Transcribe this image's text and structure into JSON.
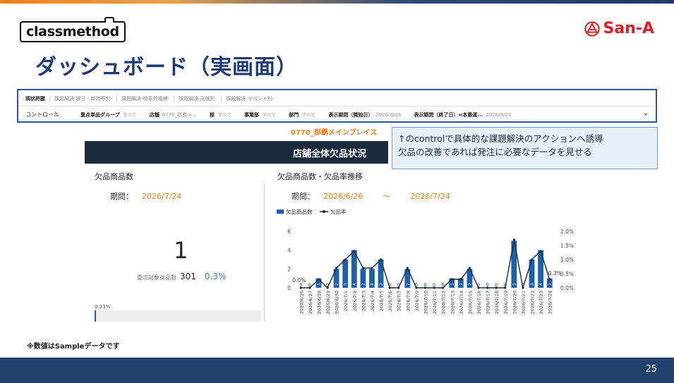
{
  "header": {
    "brand_left": "classmethod",
    "brand_right": "San-A",
    "title": "ダッシュボード（実画面）",
    "accent_color": "#1f3a70"
  },
  "filters": {
    "tabs": [
      "現状把握",
      "課題解決-曜日・時間帯別-",
      "課題解決-時系列推移-",
      "課題解決-天候別-",
      "課題解決-イベント別-"
    ],
    "active_tab": 0,
    "controls_label": "コントロール",
    "controls": [
      {
        "name": "重点単品グループ",
        "value": "すべて"
      },
      {
        "name": "店舗",
        "value": "0770_那覇メ..."
      },
      {
        "name": "部",
        "value": "すべて"
      },
      {
        "name": "事業部",
        "value": "すべて"
      },
      {
        "name": "部門",
        "value": "すべて"
      },
      {
        "name": "表示期間（開始日）",
        "value": "2026/6/26"
      },
      {
        "name": "表示期間（終了日）=本番運...",
        "value": "2026/7/24"
      }
    ]
  },
  "store_name": "0770_那覇メインプレイス",
  "banner_title": "店舗全体欠品状況",
  "callout": {
    "line1": "↑のcontrolで具体的な課題解決のアクションへ誘導",
    "line2": "欠品の改善であれば発注に必要なデータを見せる"
  },
  "left_panel": {
    "title": "欠品商品数",
    "period_label": "期間：",
    "period_date": "2026/7/24",
    "value": "1",
    "sub_label": "重点対象商品数",
    "sub_value": "301",
    "sub_rate": "0.3%",
    "gauge_label": "0.33%",
    "gauge_fraction": 0.0033
  },
  "right_panel": {
    "title": "欠品商品数・欠品率推移",
    "period_label": "期間：",
    "period_start": "2026/6/26",
    "period_sep": "〜",
    "period_end": "2026/7/24"
  },
  "chart_data": {
    "type": "bar",
    "legend": [
      "欠品商品数",
      "欠品率"
    ],
    "legend_position": "top-left",
    "categories": [
      "2026/6/26",
      "2026/6/27",
      "2026/6/28",
      "2026/6/29",
      "2026/6/30",
      "2026/7/1",
      "2026/7/2",
      "2026/7/3",
      "2026/7/4",
      "2026/7/5",
      "2026/7/6",
      "2026/7/7",
      "2026/7/8",
      "2026/7/9",
      "2026/7/10",
      "2026/7/11",
      "2026/7/12",
      "2026/7/13",
      "2026/7/14",
      "2026/7/15",
      "2026/7/16",
      "2026/7/17",
      "2026/7/18",
      "2026/7/19",
      "2026/7/20",
      "2026/7/21",
      "2026/7/22",
      "2026/7/23",
      "2026/7/24"
    ],
    "series": [
      {
        "name": "欠品商品数",
        "kind": "bar",
        "axis": "left",
        "values": [
          0,
          0,
          1,
          0,
          2,
          3,
          4,
          2,
          2,
          3,
          0,
          0,
          2,
          0,
          0,
          0,
          0,
          1,
          1,
          2,
          0,
          0,
          0,
          0,
          5,
          0,
          3,
          4,
          1
        ]
      },
      {
        "name": "欠品率",
        "kind": "line",
        "axis": "right",
        "values": [
          0,
          0,
          0.3,
          0,
          0.7,
          1.0,
          1.3,
          0.7,
          0.7,
          1.0,
          0,
          0,
          0.7,
          0,
          0,
          0,
          0,
          0.3,
          0.3,
          0.7,
          0,
          0,
          0,
          0,
          1.7,
          0,
          1.0,
          1.3,
          0.3
        ]
      }
    ],
    "bar_labels": [
      "0",
      "0",
      "1",
      "0",
      "2",
      "3",
      "4",
      "2",
      "2",
      "3",
      "0",
      "0",
      "2",
      "0",
      "0",
      "0",
      "0",
      "1",
      "1",
      "2",
      "0",
      "0",
      "0",
      "0",
      "5",
      "0",
      "3",
      "4",
      "1"
    ],
    "point_labels": {
      "first": "0.0%",
      "last": "0.3%"
    },
    "y_left": {
      "ticks": [
        "0",
        "2",
        "4",
        "6"
      ],
      "range": [
        0,
        6
      ]
    },
    "y_right": {
      "ticks": [
        "0.0%",
        "0.5%",
        "1.0%",
        "1.5%",
        "2.0%"
      ],
      "range": [
        0,
        2.0
      ]
    },
    "bar_color": "#1f5fa6",
    "line_color": "#1b2a3d",
    "grid": false
  },
  "footnote": "※数値はSampleデータです",
  "page_number": "25"
}
